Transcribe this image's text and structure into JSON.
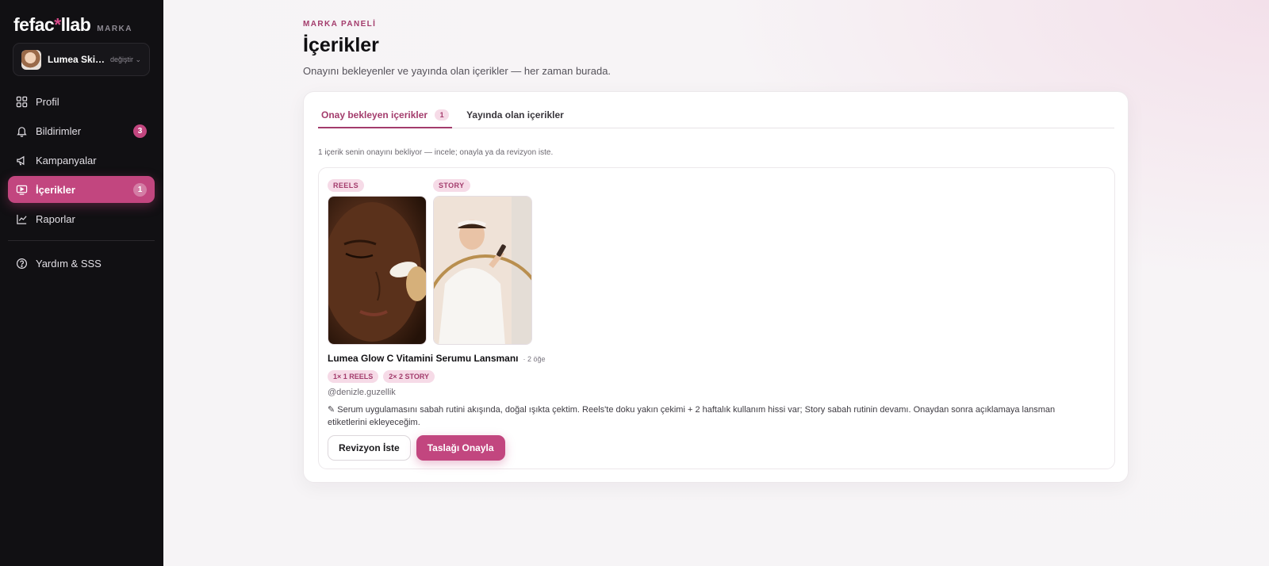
{
  "sidebar": {
    "logo_text_a": "fefac",
    "logo_star": "*",
    "logo_text_b": "llab",
    "logo_tag": "MARKA",
    "brand": {
      "name": "Lumea Skin...",
      "change_label": "değiştir ⌄"
    },
    "items": [
      {
        "label": "Profil",
        "icon": "grid-icon"
      },
      {
        "label": "Bildirimler",
        "icon": "bell-icon",
        "badge": "3"
      },
      {
        "label": "Kampanyalar",
        "icon": "megaphone-icon"
      },
      {
        "label": "İçerikler",
        "icon": "play-screen-icon",
        "badge": "1",
        "active": true
      },
      {
        "label": "Raporlar",
        "icon": "chart-icon"
      },
      {
        "label": "Yardım & SSS",
        "icon": "help-icon"
      }
    ]
  },
  "header": {
    "eyebrow": "MARKA PANELİ",
    "title": "İçerikler",
    "subtitle": "Onayını bekleyenler ve yayında olan içerikler — her zaman burada."
  },
  "tabs": [
    {
      "label": "Onay bekleyen içerikler",
      "count": "1",
      "active": true
    },
    {
      "label": "Yayında olan içerikler"
    }
  ],
  "hint": "1 içerik senin onayını bekliyor — incele; onayla ya da revizyon iste.",
  "card": {
    "media": [
      {
        "tag": "REELS",
        "image": "woman applying cream to cheek"
      },
      {
        "tag": "STORY",
        "image": "woman in bathrobe holding serum at mirror"
      }
    ],
    "title": "Lumea Glow C Vitamini Serumu Lansmanı",
    "count": "· 2 öğe",
    "chips": [
      "1× 1 REELS",
      "2× 2 STORY"
    ],
    "handle": "@denizle.guzellik",
    "note": "✎ Serum uygulamasını sabah rutini akışında, doğal ışıkta çektim. Reels'te doku yakın çekimi + 2 haftalık kullanım hissi var; Story sabah rutinin devamı. Onaydan sonra açıklamaya lansman etiketlerini ekleyeceğim.",
    "revise_label": "Revizyon İste",
    "approve_label": "Taslağı Onayla"
  },
  "colors": {
    "accent": "#c2467f",
    "sidebar_bg": "#111013",
    "chip_bg": "#f6dbe7"
  }
}
